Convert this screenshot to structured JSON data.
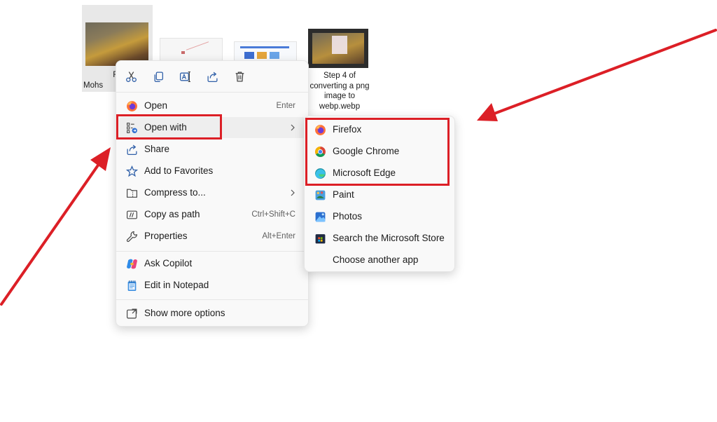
{
  "files": {
    "left_name_line1": "Fa",
    "left_name_line2": "Mohs",
    "right_name_lines": [
      "Step 4 of",
      "converting a png",
      "image to",
      "webp.webp"
    ]
  },
  "context_menu": {
    "toolbar": [
      {
        "name": "cut-icon"
      },
      {
        "name": "copy-icon"
      },
      {
        "name": "rename-icon"
      },
      {
        "name": "share-icon"
      },
      {
        "name": "delete-icon"
      }
    ],
    "items": [
      {
        "label": "Open",
        "shortcut": "Enter",
        "icon": "firefox-icon"
      },
      {
        "label": "Open with",
        "shortcut": "",
        "icon": "open-with-icon",
        "submenu": true
      },
      {
        "label": "Share",
        "shortcut": "",
        "icon": "share-icon"
      },
      {
        "label": "Add to Favorites",
        "shortcut": "",
        "icon": "star-icon"
      },
      {
        "label": "Compress to...",
        "shortcut": "",
        "icon": "folder-zip-icon",
        "submenu": true
      },
      {
        "label": "Copy as path",
        "shortcut": "Ctrl+Shift+C",
        "icon": "copy-path-icon"
      },
      {
        "label": "Properties",
        "shortcut": "Alt+Enter",
        "icon": "wrench-icon"
      },
      {
        "label": "Ask Copilot",
        "shortcut": "",
        "icon": "copilot-icon"
      },
      {
        "label": "Edit in Notepad",
        "shortcut": "",
        "icon": "notepad-icon"
      },
      {
        "label": "Show more options",
        "shortcut": "",
        "icon": "more-options-icon"
      }
    ]
  },
  "open_with_submenu": {
    "items": [
      {
        "label": "Firefox",
        "icon": "firefox-icon"
      },
      {
        "label": "Google Chrome",
        "icon": "chrome-icon"
      },
      {
        "label": "Microsoft Edge",
        "icon": "edge-icon"
      },
      {
        "label": "Paint",
        "icon": "paint-icon"
      },
      {
        "label": "Photos",
        "icon": "photos-icon"
      },
      {
        "label": "Search the Microsoft Store",
        "icon": "store-icon"
      },
      {
        "label": "Choose another app",
        "icon": ""
      }
    ]
  },
  "colors": {
    "highlight_red": "#dc1f26",
    "menu_bg": "#f9f9f9",
    "hover_bg": "#eeeeee"
  }
}
